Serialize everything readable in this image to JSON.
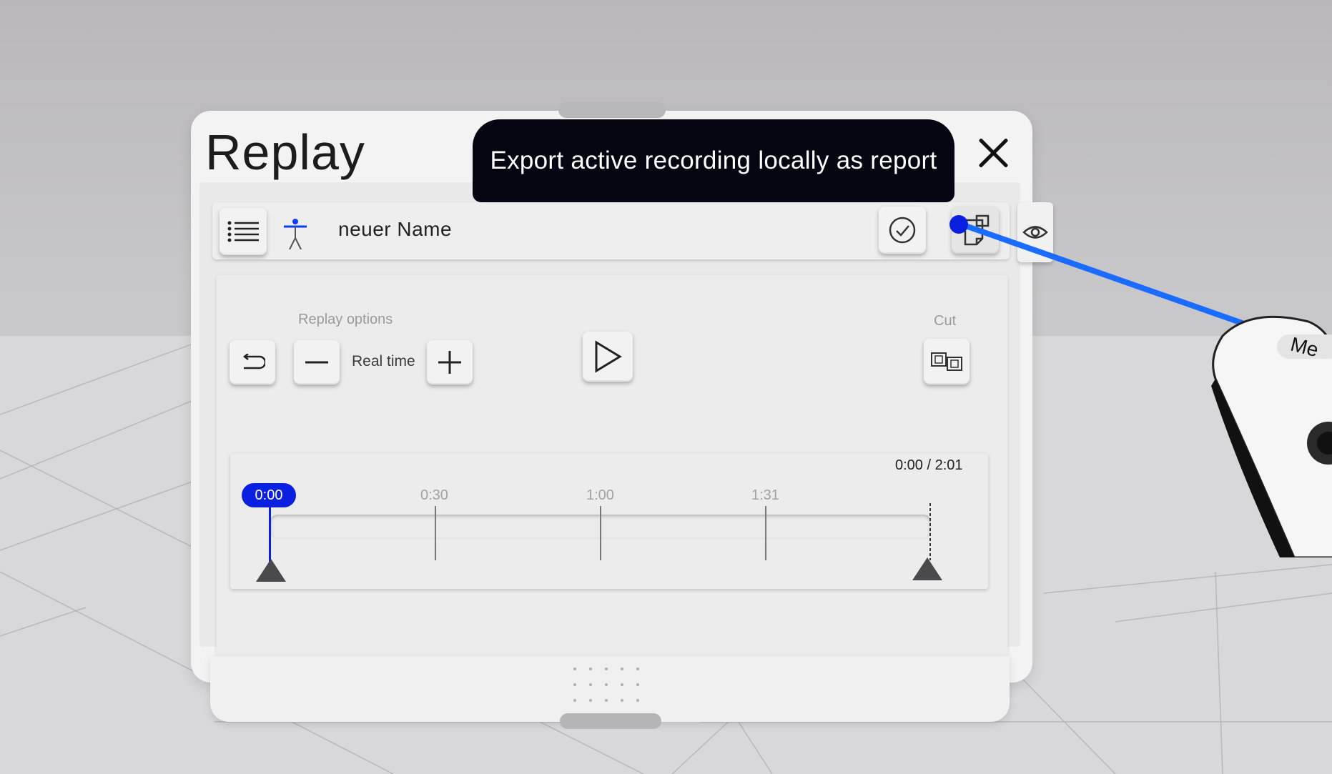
{
  "window": {
    "title": "Replay",
    "close_label": "close"
  },
  "tooltip": {
    "text": "Export active recording locally as report"
  },
  "recording": {
    "name": "neuer Name"
  },
  "replay_options": {
    "section_label": "Replay options",
    "speed_label": "Real time",
    "cut_label": "Cut"
  },
  "timeline": {
    "readout": "0:00 / 2:01",
    "current": "0:00",
    "ticks": [
      "0:30",
      "1:00",
      "1:31"
    ],
    "progress": 0
  },
  "controller": {
    "label": "Me"
  },
  "colors": {
    "accent": "#0a1fe0",
    "tooltip_bg": "#060612",
    "laser": "#1a6bff"
  }
}
